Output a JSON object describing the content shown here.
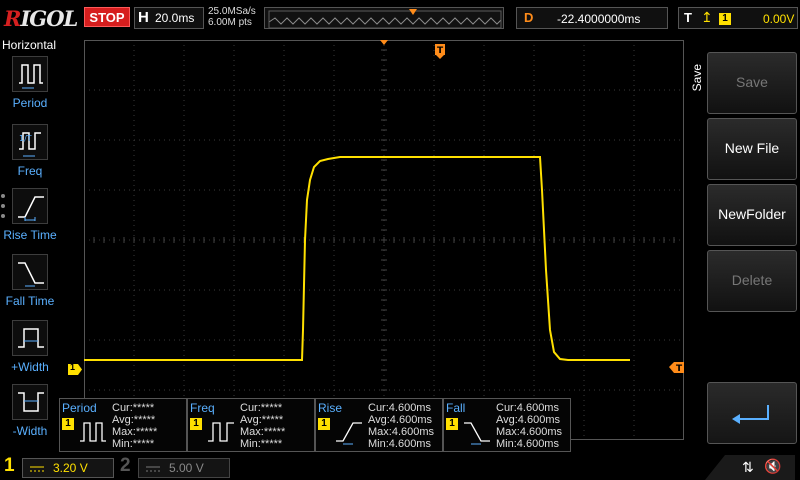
{
  "brand": {
    "prefix": "R",
    "rest": "IGOL"
  },
  "run_state": "STOP",
  "timebase": {
    "label": "H",
    "value": "20.0ms"
  },
  "sampling": {
    "rate": "25.0MSa/s",
    "points": "6.00M pts"
  },
  "delay": {
    "label": "D",
    "value": "-22.4000000ms"
  },
  "trigger": {
    "label": "T",
    "edge_icon": "rising-edge-icon",
    "source": "1",
    "level": "0.00V"
  },
  "left_menu": {
    "title": "Horizontal",
    "items": [
      {
        "label": "Period",
        "icon": "period-icon"
      },
      {
        "label": "Freq",
        "icon": "freq-icon"
      },
      {
        "label": "Rise Time",
        "icon": "rise-time-icon"
      },
      {
        "label": "Fall Time",
        "icon": "fall-time-icon"
      },
      {
        "label": "+Width",
        "icon": "pos-width-icon"
      },
      {
        "label": "-Width",
        "icon": "neg-width-icon"
      }
    ]
  },
  "right_menu": {
    "title": "Save",
    "buttons": [
      {
        "label": "Save",
        "enabled": false
      },
      {
        "label": "New File",
        "enabled": true
      },
      {
        "label": "NewFolder",
        "enabled": true
      },
      {
        "label": "Delete",
        "enabled": false
      }
    ]
  },
  "channel_marker": "1",
  "measurements": [
    {
      "name": "Period",
      "channel": "1",
      "cur": "Cur:*****",
      "avg": "Avg:*****",
      "max": "Max:*****",
      "min": "Min:*****"
    },
    {
      "name": "Freq",
      "channel": "1",
      "cur": "Cur:*****",
      "avg": "Avg:*****",
      "max": "Max:*****",
      "min": "Min:*****"
    },
    {
      "name": "Rise",
      "channel": "1",
      "cur": "Cur:4.600ms",
      "avg": "Avg:4.600ms",
      "max": "Max:4.600ms",
      "min": "Min:4.600ms"
    },
    {
      "name": "Fall",
      "channel": "1",
      "cur": "Cur:4.600ms",
      "avg": "Avg:4.600ms",
      "max": "Max:4.600ms",
      "min": "Min:4.600ms"
    }
  ],
  "channels": [
    {
      "num": "1",
      "scale": "3.20 V",
      "enabled": true
    },
    {
      "num": "2",
      "scale": "5.00 V",
      "enabled": false
    }
  ],
  "colors": {
    "ch1": "#ffe000",
    "accent_blue": "#5ab0ff",
    "trigger_orange": "#ff8c1a",
    "stop_red": "#d61e1e"
  }
}
